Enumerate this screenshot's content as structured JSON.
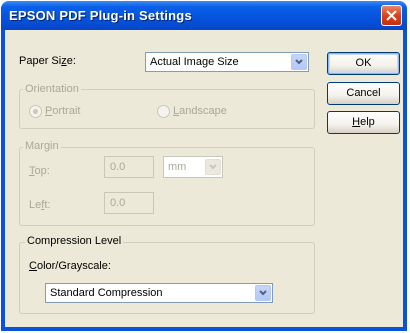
{
  "window": {
    "title": "EPSON PDF Plug-in Settings"
  },
  "paper_size": {
    "label_prefix": "Paper Si",
    "label_mnemonic": "z",
    "label_suffix": "e:",
    "value": "Actual Image Size"
  },
  "orientation": {
    "legend": "Orientation",
    "portrait_mnemonic": "P",
    "portrait_rest": "ortrait",
    "landscape_mnemonic": "L",
    "landscape_rest": "andscape",
    "selected": "Portrait"
  },
  "margin": {
    "legend": "Margin",
    "top_mnemonic": "T",
    "top_rest": "op:",
    "top_value": "0.0",
    "unit": "mm",
    "left_prefix": "Le",
    "left_mnemonic": "f",
    "left_suffix": "t:",
    "left_value": "0.0"
  },
  "compression": {
    "legend": "Compression Level",
    "label_mnemonic": "C",
    "label_rest": "olor/Grayscale:",
    "value": "Standard Compression"
  },
  "buttons": {
    "ok": "OK",
    "cancel": "Cancel",
    "help_mnemonic": "H",
    "help_rest": "elp"
  }
}
